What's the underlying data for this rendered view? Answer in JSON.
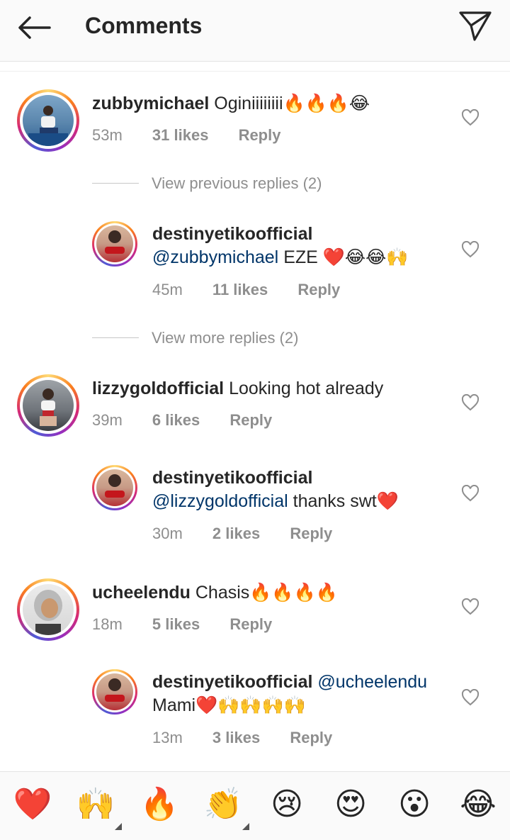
{
  "header": {
    "title": "Comments",
    "back_icon": "back-arrow-icon",
    "send_icon": "paper-plane-icon"
  },
  "comments": [
    {
      "username": "zubbymichael",
      "text": "Oginiiiiiiii🔥🔥🔥😂",
      "time": "53m",
      "likes": "31 likes",
      "reply": "Reply"
    },
    {
      "username": "destinyetikoofficial",
      "mention": "@zubbymichael",
      "text": " EZE ❤️😂😂🙌",
      "time": "45m",
      "likes": "11 likes",
      "reply": "Reply"
    },
    {
      "username": "lizzygoldofficial",
      "text": "Looking hot already",
      "time": "39m",
      "likes": "6 likes",
      "reply": "Reply"
    },
    {
      "username": "destinyetikoofficial",
      "mention": "@lizzygoldofficial",
      "text": " thanks swt❤️",
      "time": "30m",
      "likes": "2 likes",
      "reply": "Reply"
    },
    {
      "username": "ucheelendu",
      "text": "Chasis🔥🔥🔥🔥",
      "time": "18m",
      "likes": "5 likes",
      "reply": "Reply"
    },
    {
      "username": "destinyetikoofficial",
      "mention": "@ucheelendu",
      "text": "Mami❤️🙌🙌🙌🙌",
      "time": "13m",
      "likes": "3 likes",
      "reply": "Reply"
    }
  ],
  "links": {
    "view_previous": "View previous replies (2)",
    "view_more": "View more replies (2)"
  },
  "quick_reactions": [
    "❤️",
    "🙌",
    "🔥",
    "👏",
    "😢",
    "😍",
    "😮",
    "😂"
  ],
  "colors": {
    "mention": "#003569",
    "meta": "#8e8e8e",
    "text": "#262626"
  }
}
